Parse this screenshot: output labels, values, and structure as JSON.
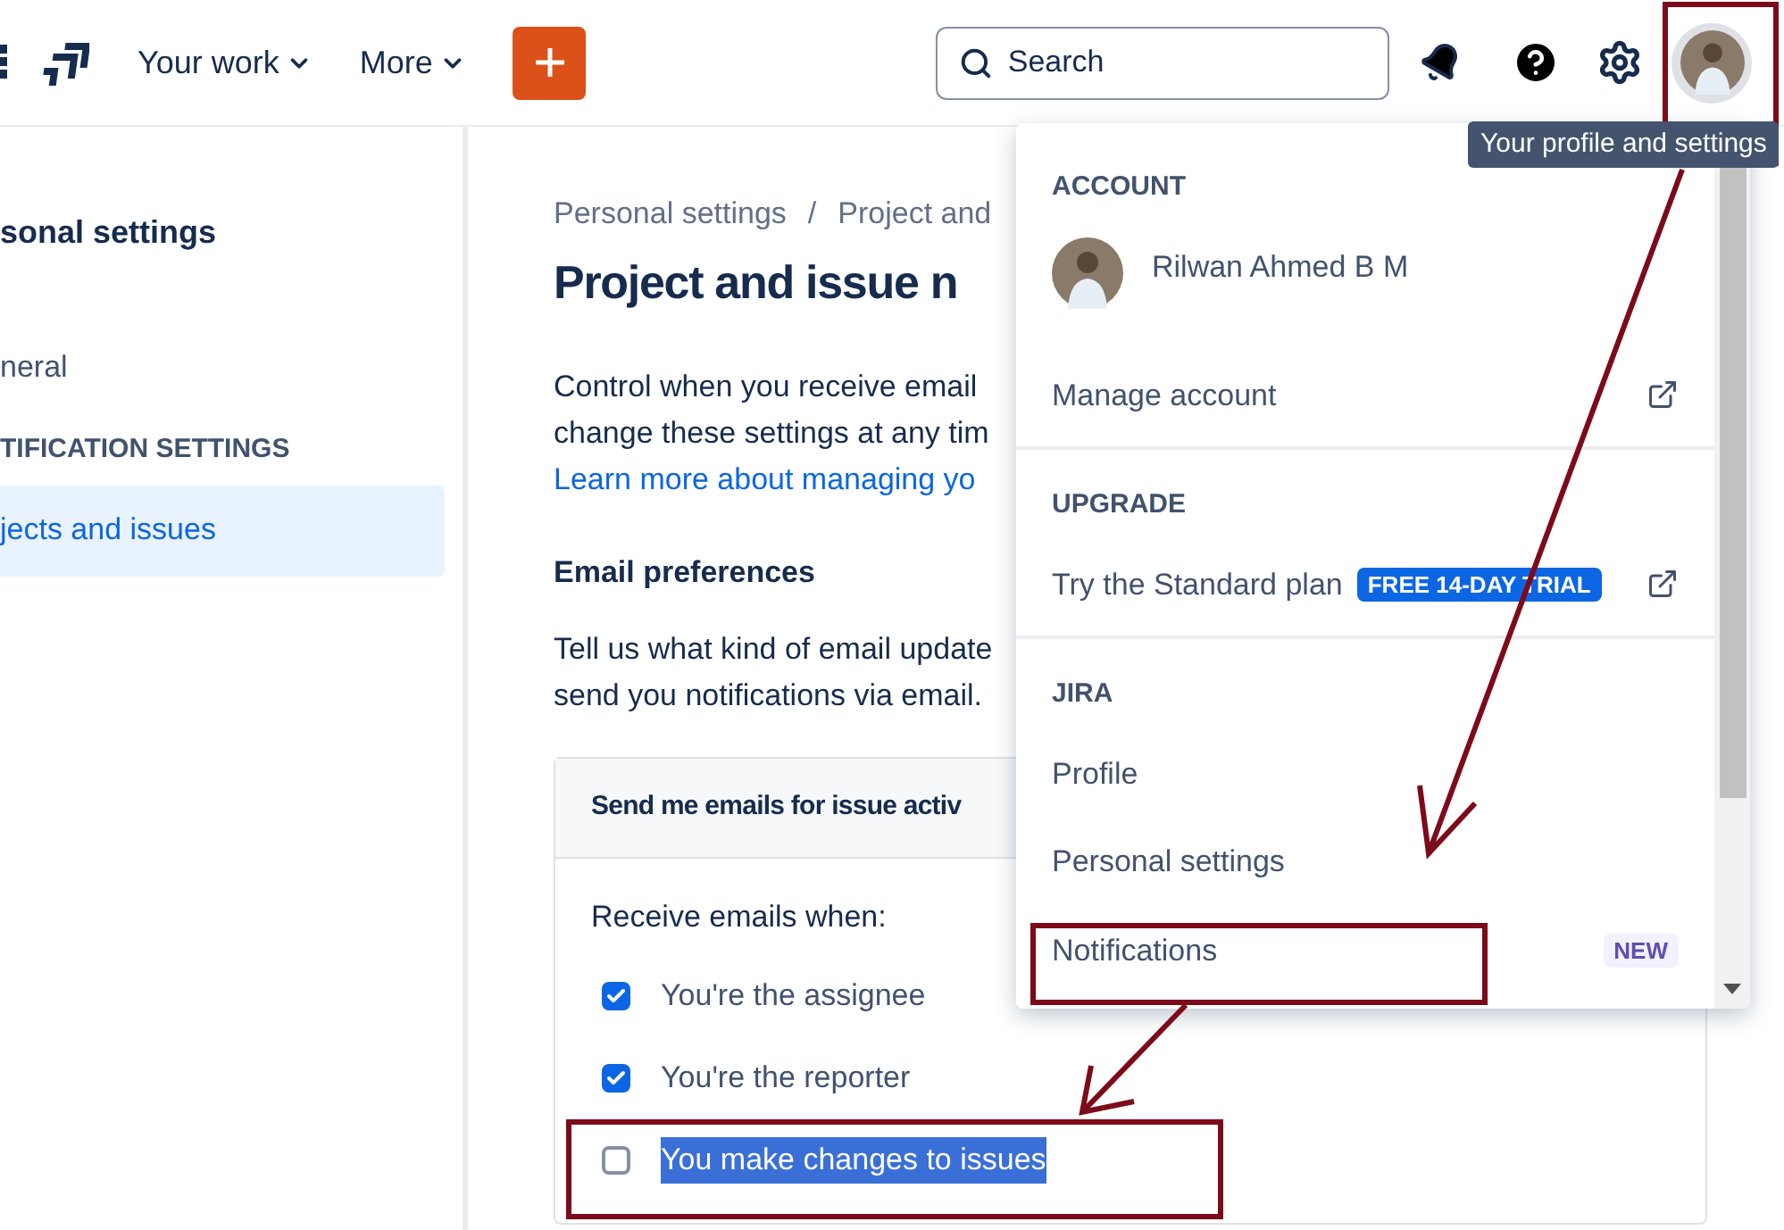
{
  "top_bar": {
    "nav": [
      {
        "label": "Your work"
      },
      {
        "label": "More"
      }
    ],
    "search": {
      "placeholder": "Search"
    },
    "tooltip": "Your profile and settings"
  },
  "sidebar": {
    "title": "sonal settings",
    "items": [
      {
        "label": "neral",
        "selected": false
      }
    ],
    "section": "TIFICATION SETTINGS",
    "section_items": [
      {
        "label": "jects and issues",
        "selected": true
      }
    ]
  },
  "main": {
    "breadcrumb": [
      "Personal settings",
      "/",
      "Project and"
    ],
    "title": "Project and issue n",
    "intro_lines": [
      "Control when you receive email",
      "change these settings at any tim"
    ],
    "link": "Learn more about managing yo",
    "email_heading": "Email preferences",
    "email_lines": [
      "Tell us what kind of email update",
      "send you notifications via email."
    ],
    "card": {
      "title": "Send me emails for issue activ",
      "subtitle": "Receive emails when:",
      "options": [
        {
          "label": "You're the assignee",
          "checked": true,
          "text_selected": false
        },
        {
          "label": "You're the reporter",
          "checked": true,
          "text_selected": false
        },
        {
          "label": "You make changes to issues",
          "checked": false,
          "text_selected": true
        }
      ]
    }
  },
  "menu": {
    "sections": [
      {
        "heading": "ACCOUNT",
        "items": [
          {
            "kind": "user",
            "label": "Rilwan Ahmed B M"
          },
          {
            "kind": "external",
            "label": "Manage account"
          }
        ]
      },
      {
        "heading": "UPGRADE",
        "items": [
          {
            "kind": "external",
            "label": "Try the Standard plan",
            "badge": "FREE 14-DAY TRIAL"
          }
        ]
      },
      {
        "heading": "JIRA",
        "items": [
          {
            "kind": "link",
            "label": "Profile"
          },
          {
            "kind": "link",
            "label": "Personal settings"
          },
          {
            "kind": "new",
            "label": "Notifications",
            "badge": "NEW"
          }
        ]
      }
    ]
  }
}
